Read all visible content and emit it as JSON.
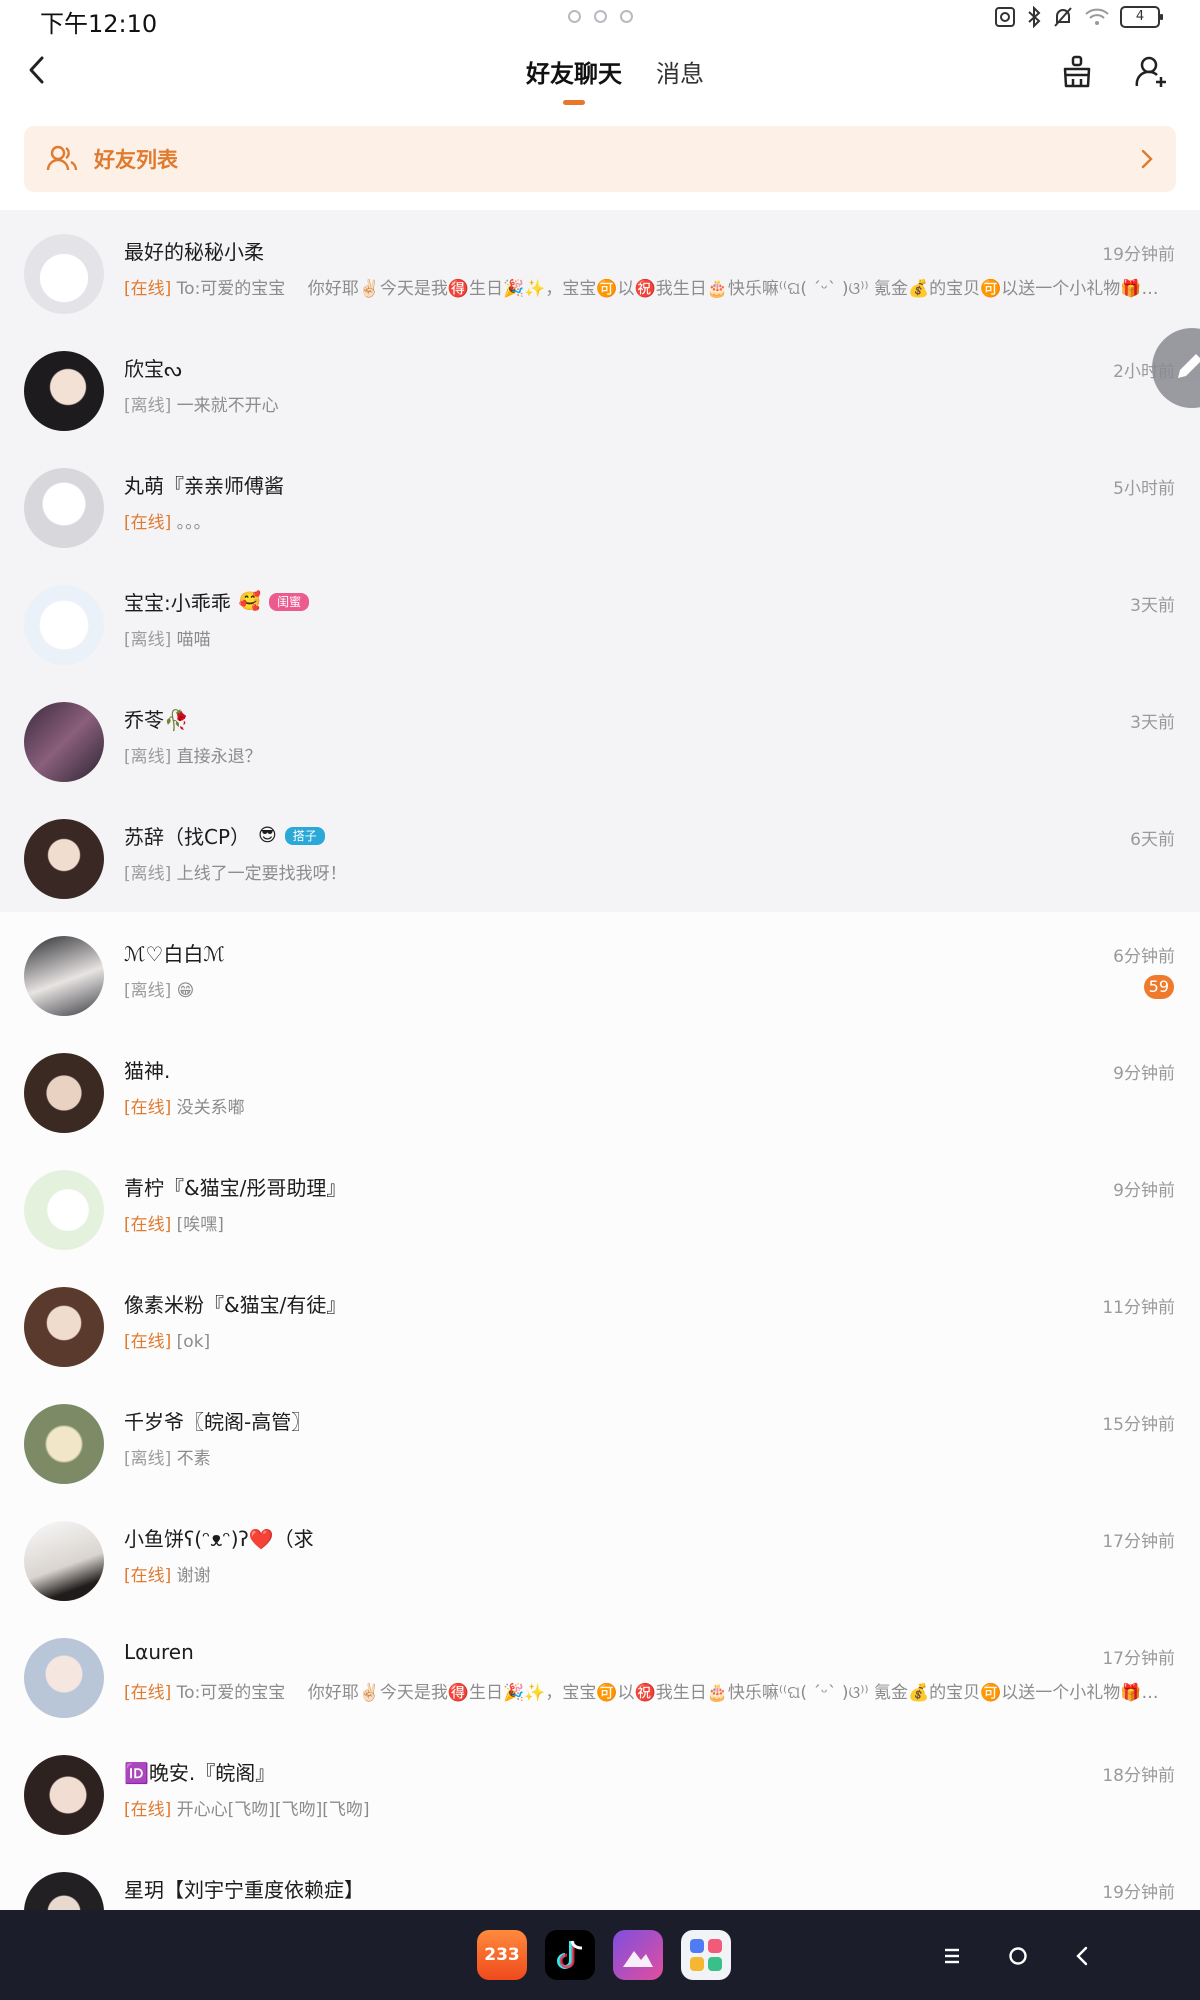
{
  "status_bar": {
    "time": "下午12:10",
    "battery": "4"
  },
  "header": {
    "tabs": [
      {
        "label": "好友聊天",
        "active": true
      },
      {
        "label": "消息",
        "active": false
      }
    ],
    "icons": [
      "back-icon",
      "cleanup-broom-icon",
      "add-friend-icon"
    ]
  },
  "friends_bar": {
    "label": "好友列表"
  },
  "colors": {
    "accent": "#e8762c",
    "online": "#e07a2e",
    "badge": "#ee7b2d",
    "dock": "#1c1d2b"
  },
  "pinned_chats": [
    {
      "name": "最好的秘秘小柔",
      "time": "19分钟前",
      "status": "[在线]",
      "online": true,
      "message": "To:可爱的宝宝　 你好耶✌🏻今天是我🉐生日🎉✨，宝宝🉑以㊗️我生日🎂快乐嘛⁽⁽ଘ( ˊᵕˋ )ଓ⁾⁾ 氪金💰的宝贝🉑以送一个小礼物🎁…"
    },
    {
      "name": "欣宝ᔓ",
      "time": "2小时前",
      "status": "[离线]",
      "online": false,
      "message": "一来就不开心"
    },
    {
      "name": "丸萌『亲亲师傅酱",
      "time": "5小时前",
      "status": "[在线]",
      "online": true,
      "message": "。。。"
    },
    {
      "name": "宝宝:小乖乖",
      "tag": "闺蜜",
      "time": "3天前",
      "status": "[离线]",
      "online": false,
      "message": "喵喵"
    },
    {
      "name": "乔苓🥀",
      "time": "3天前",
      "status": "[离线]",
      "online": false,
      "message": "直接永退？"
    },
    {
      "name": "苏辞（找CP）",
      "tag": "搭子",
      "time": "6天前",
      "status": "[离线]",
      "online": false,
      "message": "上线了一定要找我呀！"
    }
  ],
  "chats": [
    {
      "name": "ℳ♡白白ℳ",
      "time": "6分钟前",
      "status": "[离线]",
      "online": false,
      "message": "😁",
      "unread": "59"
    },
    {
      "name": "猫神.",
      "time": "9分钟前",
      "status": "[在线]",
      "online": true,
      "message": "没关系嘟"
    },
    {
      "name": "青柠『&猫宝/彤哥助理』",
      "time": "9分钟前",
      "status": "[在线]",
      "online": true,
      "message": "[唉嘿]"
    },
    {
      "name": "像素米粉『&猫宝/有徒』",
      "time": "11分钟前",
      "status": "[在线]",
      "online": true,
      "message": "[ok]"
    },
    {
      "name": "千岁爷〖皖阁-高管〗",
      "time": "15分钟前",
      "status": "[离线]",
      "online": false,
      "message": "不素"
    },
    {
      "name": "小鱼饼ʕ(ᵔᴥᵔ)ʔ❤️（求",
      "time": "17分钟前",
      "status": "[在线]",
      "online": true,
      "message": "谢谢"
    },
    {
      "name": "Lαuren",
      "time": "17分钟前",
      "status": "[在线]",
      "online": true,
      "message": "To:可爱的宝宝　 你好耶✌🏻今天是我🉐生日🎉✨，宝宝🉑以㊗️我生日🎂快乐嘛⁽⁽ଘ( ˊᵕˋ )ଓ⁾⁾ 氪金💰的宝贝🉑以送一个小礼物🎁…"
    },
    {
      "name": "🆔晚安.『皖阁』",
      "time": "18分钟前",
      "status": "[在线]",
      "online": true,
      "message": "开心心[飞吻][飞吻][飞吻]"
    },
    {
      "name": "星玥【刘宇宁重度依赖症】",
      "time": "19分钟前",
      "status": "",
      "online": false,
      "message": ""
    }
  ],
  "dock": {
    "apps": [
      {
        "label": "233"
      },
      {
        "label": "tiktok"
      },
      {
        "label": "gallery"
      },
      {
        "label": "app-store"
      }
    ]
  }
}
